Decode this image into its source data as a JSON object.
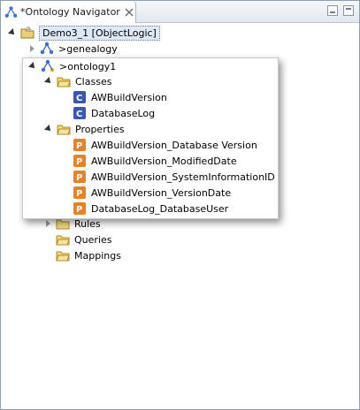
{
  "tab": {
    "title": "*Ontology Navigator",
    "icon": "ontology-navigator-icon",
    "close_icon": "close-icon"
  },
  "window_buttons": [
    "minimize-icon",
    "maximize-icon"
  ],
  "tree": {
    "root": {
      "label": "Demo3_1 [ObjectLogic]",
      "icon": "project-icon"
    },
    "genealogy": {
      "label": ">genealogy",
      "icon": "ontology-icon"
    },
    "ontology1": {
      "label": ">ontology1",
      "icon": "ontology-icon"
    },
    "classes": {
      "label": "Classes",
      "icon": "folder-open-icon",
      "items": [
        "AWBuildVersion",
        "DatabaseLog"
      ]
    },
    "properties": {
      "label": "Properties",
      "icon": "folder-open-icon",
      "items": [
        "AWBuildVersion_Database Version",
        "AWBuildVersion_ModifiedDate",
        "AWBuildVersion_SystemInformationID",
        "AWBuildVersion_VersionDate",
        "DatabaseLog_DatabaseUser"
      ]
    },
    "rules": {
      "label": "Rules",
      "icon": "folder-closed-icon"
    },
    "queries": {
      "label": "Queries",
      "icon": "folder-icon"
    },
    "mappings": {
      "label": "Mappings",
      "icon": "folder-icon"
    }
  },
  "colors": {
    "class_icon": "#3a56b0",
    "property_icon": "#e8822a",
    "folder": "#e7c15a",
    "selection": "#dfe8f6"
  }
}
